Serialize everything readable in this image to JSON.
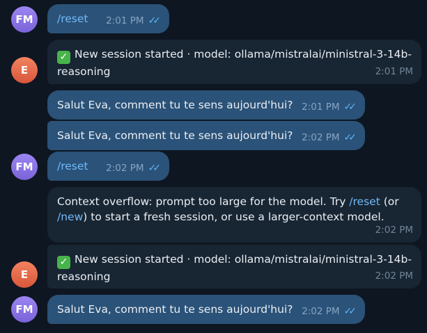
{
  "users": {
    "fm": {
      "initials": "FM",
      "color": "#8b74e6"
    },
    "e": {
      "initials": "E",
      "color": "#e66b4b"
    }
  },
  "messages": [
    {
      "id": "m1",
      "text": "/reset",
      "time": "2:01 PM",
      "status": "read"
    },
    {
      "id": "m2",
      "icon": "check-mark-emoji",
      "line1": "New session started · model: ollama/mistralai/ministral-3-14b-",
      "line2": "reasoning",
      "time": "2:01 PM"
    },
    {
      "id": "m3",
      "text": "Salut Eva, comment tu te sens aujourd'hui?",
      "time": "2:01 PM",
      "status": "read"
    },
    {
      "id": "m4",
      "text": "Salut Eva, comment tu te sens aujourd'hui?",
      "time": "2:02 PM",
      "status": "read"
    },
    {
      "id": "m5",
      "text": "/reset",
      "time": "2:02 PM",
      "status": "read"
    },
    {
      "id": "m6",
      "line1_a": "Context overflow: prompt too large for the model. Try ",
      "line1_link": "/reset",
      "line1_b": " (or",
      "line2_link": "/new",
      "line2_b": ") to start a fresh session, or use a larger-context model.",
      "time": "2:02 PM"
    },
    {
      "id": "m7",
      "icon": "check-mark-emoji",
      "line1": "New session started · model: ollama/mistralai/ministral-3-14b-",
      "line2": "reasoning",
      "time": "2:02 PM"
    },
    {
      "id": "m8",
      "text": "Salut Eva, comment tu te sens aujourd'hui?",
      "time": "2:02 PM",
      "status": "read"
    }
  ],
  "colors": {
    "background": "#0e1621",
    "outgoing_bubble": "#2b5278",
    "incoming_bubble": "#182533",
    "link": "#71baf8"
  }
}
